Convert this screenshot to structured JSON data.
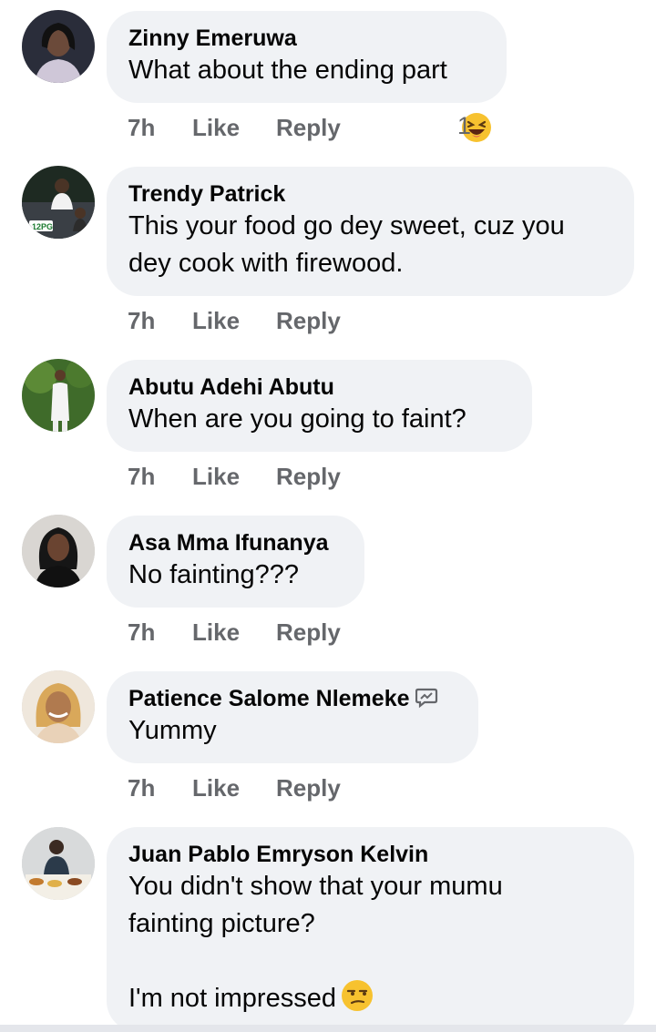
{
  "comments": [
    {
      "author": "Zinny Emeruwa",
      "text": "What about the ending part",
      "time": "7h",
      "like": "Like",
      "reply": "Reply",
      "reaction_count": "1",
      "reaction_icon": "laughing-emoji-icon"
    },
    {
      "author": "Trendy Patrick",
      "text": "This your food go dey sweet, cuz you\ndey cook with firewood.",
      "time": "7h",
      "like": "Like",
      "reply": "Reply",
      "avatar_text": "12PG"
    },
    {
      "author": "Abutu Adehi Abutu",
      "text": "When are you going to faint?",
      "time": "7h",
      "like": "Like",
      "reply": "Reply"
    },
    {
      "author": "Asa Mma Ifunanya",
      "text": "No fainting???",
      "time": "7h",
      "like": "Like",
      "reply": "Reply"
    },
    {
      "author": "Patience Salome Nlemeke",
      "text": "Yummy",
      "time": "7h",
      "like": "Like",
      "reply": "Reply",
      "badge_icon": "conversation-starter-badge-icon"
    },
    {
      "author": "Juan Pablo Emryson Kelvin",
      "text": "You didn't show that your mumu\nfainting picture?\n\nI'm not impressed",
      "text_emoji": "unamused-emoji-icon"
    }
  ],
  "colors": {
    "bubble": "#f0f2f5",
    "meta": "#65676b",
    "text": "#050505"
  }
}
